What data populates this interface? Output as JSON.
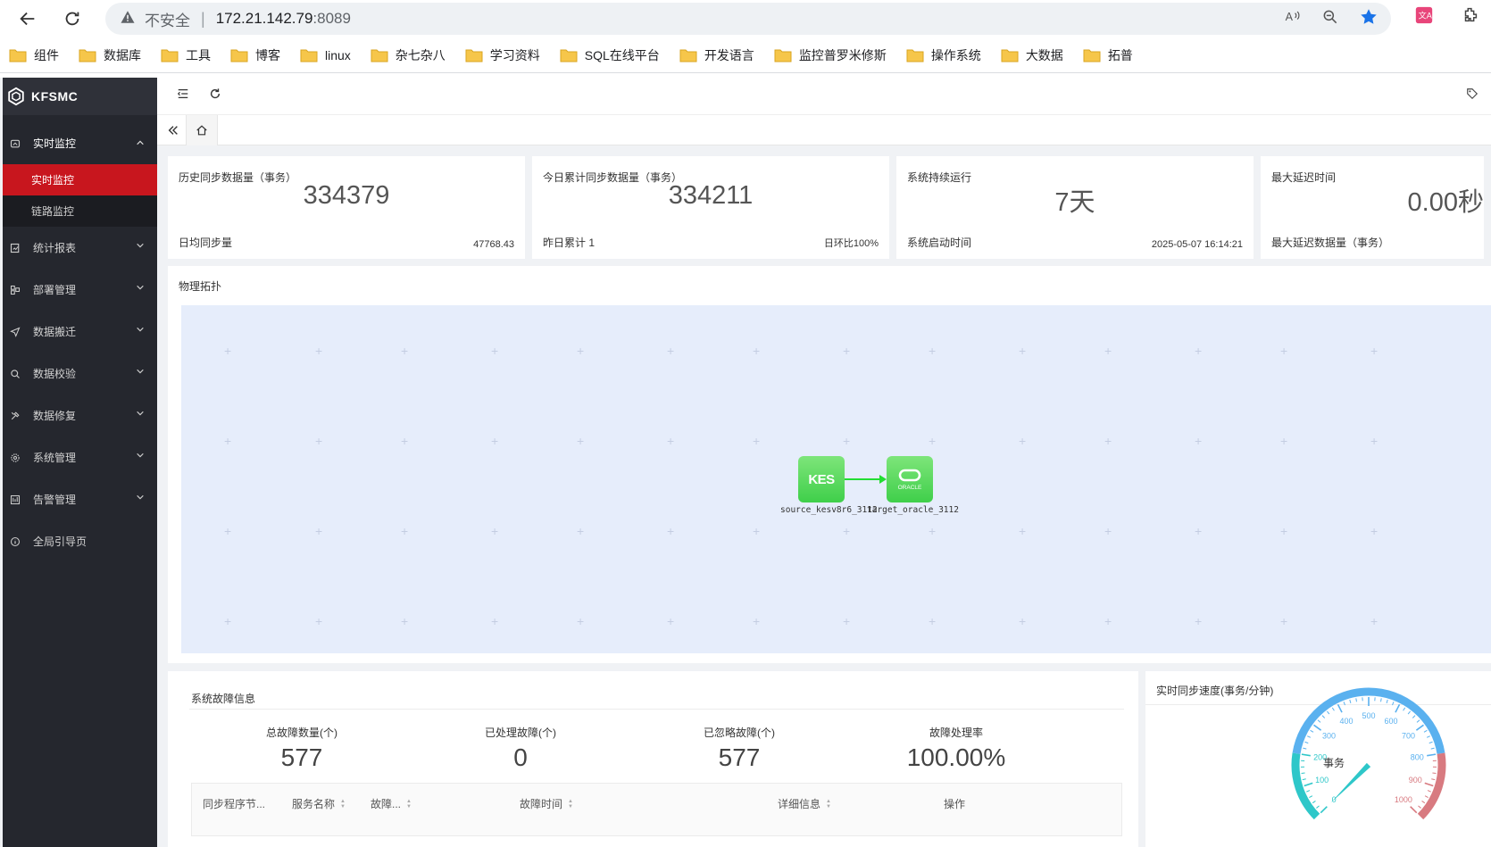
{
  "browser": {
    "insecure_label": "不安全",
    "url_host": "172.21.142.79",
    "url_port": ":8089",
    "bookmarks": [
      "组件",
      "数据库",
      "工具",
      "博客",
      "linux",
      "杂七杂八",
      "学习资料",
      "SQL在线平台",
      "开发语言",
      "监控普罗米修斯",
      "操作系统",
      "大数据",
      "拓普"
    ]
  },
  "sidebar": {
    "app_name": "KFSMC",
    "menu": [
      {
        "label": "实时监控",
        "icon": "dashboard-icon",
        "open": true
      },
      {
        "label": "统计报表",
        "icon": "report-icon"
      },
      {
        "label": "部署管理",
        "icon": "deploy-icon"
      },
      {
        "label": "数据搬迁",
        "icon": "send-icon"
      },
      {
        "label": "数据校验",
        "icon": "search-icon"
      },
      {
        "label": "数据修复",
        "icon": "repair-icon"
      },
      {
        "label": "系统管理",
        "icon": "gear-icon"
      },
      {
        "label": "告警管理",
        "icon": "alarm-icon"
      },
      {
        "label": "全局引导页",
        "icon": "info-icon"
      }
    ],
    "submenu": [
      {
        "label": "实时监控",
        "active": true
      },
      {
        "label": "链路监控",
        "active": false
      }
    ]
  },
  "cards": [
    {
      "title": "历史同步数据量（事务）",
      "value": "334379",
      "bottom_left": "日均同步量",
      "bottom_right": "47768.43"
    },
    {
      "title": "今日累计同步数据量（事务）",
      "value": "334211",
      "bottom_left": "昨日累计 1",
      "bottom_right": "日环比100%"
    },
    {
      "title": "系统持续运行",
      "value": "7天",
      "bottom_left": "系统启动时间",
      "bottom_right": "2025-05-07 16:14:21"
    },
    {
      "title": "最大延迟时间",
      "value": "0.00秒",
      "bottom_left": "最大延迟数据量（事务）",
      "bottom_right": ""
    }
  ],
  "topology": {
    "title": "物理拓扑",
    "source": {
      "logo": "KES",
      "label": "source_kesv8r6_3112"
    },
    "target": {
      "logo": "ORACLE",
      "label": "target_oracle_3112"
    },
    "colors": {
      "node": "#4bd655",
      "link": "#22dd33",
      "canvas": "#e6edfb"
    }
  },
  "fault": {
    "title": "系统故障信息",
    "stats": [
      {
        "label": "总故障数量(个)",
        "value": "577"
      },
      {
        "label": "已处理故障(个)",
        "value": "0"
      },
      {
        "label": "已忽略故障(个)",
        "value": "577"
      },
      {
        "label": "故障处理率",
        "value": "100.00%"
      }
    ],
    "columns": [
      "同步程序节...",
      "服务名称",
      "故障...",
      "故障时间",
      "详细信息",
      "操作"
    ]
  },
  "speed": {
    "title": "实时同步速度(事务/分钟)",
    "gauge_label": "事务",
    "gauge_value": 0,
    "gauge_max": 1000,
    "ticks": [
      "0",
      "100",
      "200",
      "300",
      "400",
      "500",
      "600",
      "700",
      "800",
      "900",
      "1000"
    ],
    "colors": {
      "low": "#2ec7c9",
      "mid": "#5ab1ef",
      "high": "#d87a80"
    }
  }
}
